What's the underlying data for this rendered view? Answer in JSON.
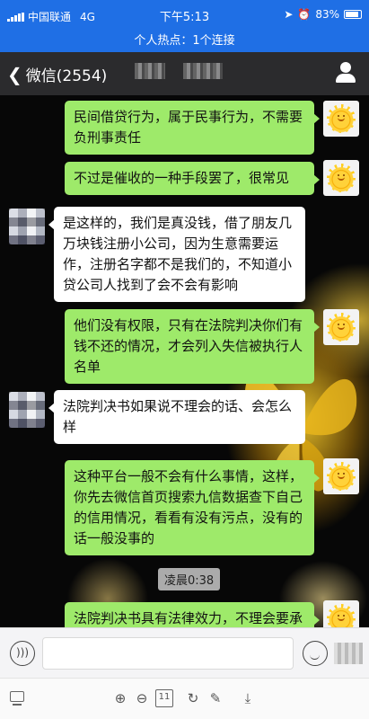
{
  "status_bar": {
    "carrier": "中国联通",
    "network": "4G",
    "time": "下午5:13",
    "battery": "83%",
    "hotspot": "个人热点：1个连接"
  },
  "nav": {
    "back_label": "微信(2554)",
    "back_icon": "chevron-left-icon",
    "profile_icon": "person-icon"
  },
  "messages": [
    {
      "side": "out",
      "text": "民间借贷行为，属于民事行为，不需要负刑事责任"
    },
    {
      "side": "out",
      "text": "不过是催收的一种手段罢了，很常见"
    },
    {
      "side": "in",
      "text": "是这样的，我们是真没钱，借了朋友几万块钱注册小公司，因为生意需要运作，注册名字都不是我们的，不知道小贷公司人找到了会不会有影响"
    },
    {
      "side": "out",
      "text": "他们没有权限，只有在法院判决你们有钱不还的情况，才会列入失信被执行人名单"
    },
    {
      "side": "in",
      "text": "法院判决书如果说不理会的话、会怎么样"
    },
    {
      "side": "out",
      "text": "这种平台一般不会有什么事情，这样，你先去微信首页搜索九信数据查下自己的信用情况，看看有没有污点，没有的话一般没事的"
    },
    {
      "side": "out",
      "text": "法院判决书具有法律效力，不理会要承担相应的法律责任"
    }
  ],
  "time_separator": "凌晨0:38",
  "input_bar": {
    "voice_icon": "voice-icon",
    "emoji_icon": "emoji-icon"
  },
  "toolbar": {
    "icons": [
      "screen-icon",
      "zoom-in-icon",
      "zoom-out-icon",
      "page-icon",
      "rotate-icon",
      "edit-icon",
      "download-icon"
    ],
    "page_label": "11"
  }
}
